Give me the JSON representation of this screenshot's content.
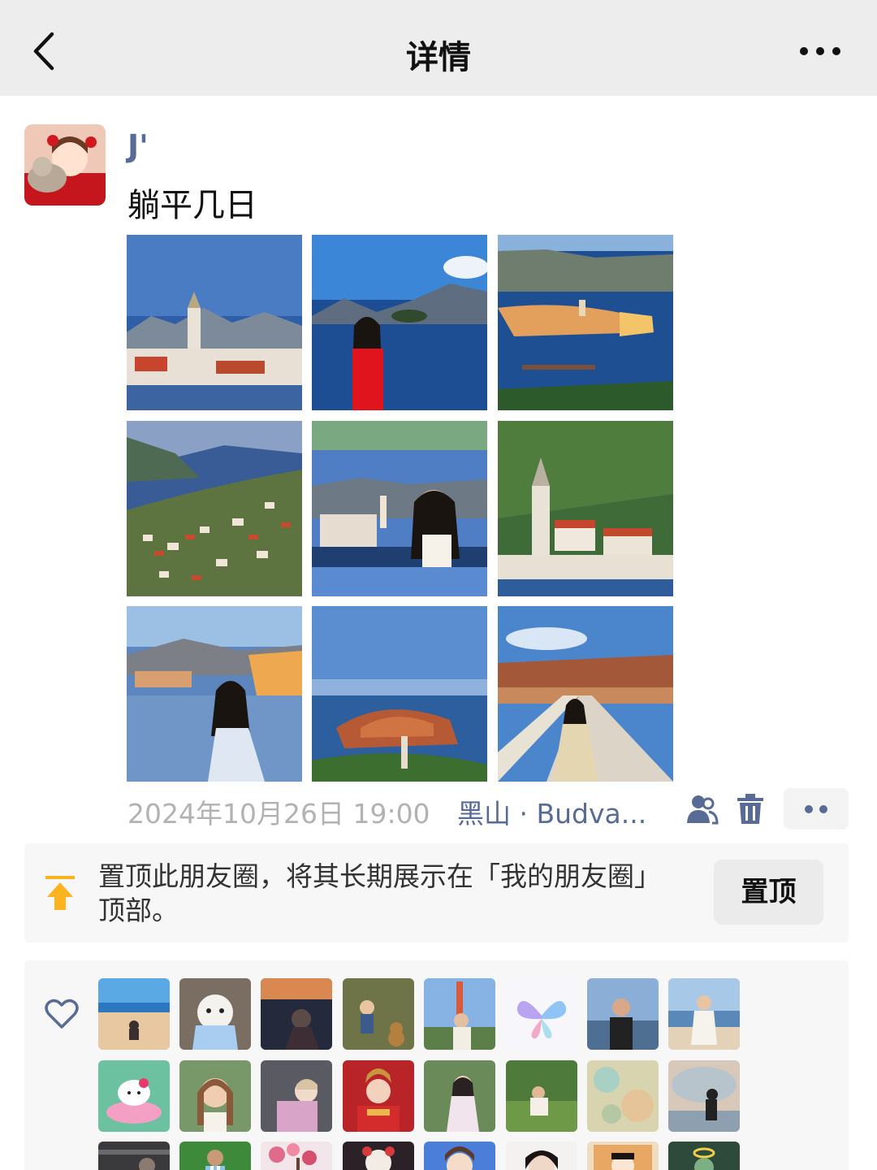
{
  "nav": {
    "title": "详情",
    "back_icon": "chevron-left-icon",
    "more_icon": "more-horizontal-icon"
  },
  "post": {
    "username": "J'",
    "text": "躺平几日",
    "photos": [
      {
        "name": "perast-church-tower-photo"
      },
      {
        "name": "woman-red-dress-bay-photo"
      },
      {
        "name": "budva-old-town-aerial-photo"
      },
      {
        "name": "kotor-bay-village-photo"
      },
      {
        "name": "woman-sunglasses-selfie-photo"
      },
      {
        "name": "perast-bell-tower-photo"
      },
      {
        "name": "woman-sitting-by-sea-photo"
      },
      {
        "name": "sveti-stefan-island-photo"
      },
      {
        "name": "woman-on-causeway-photo"
      }
    ],
    "time": "2024年10月26日 19:00",
    "location": "黑山 · Budva...",
    "dots_label": "••"
  },
  "pin": {
    "text": "置顶此朋友圈，将其长期展示在「我的朋友圈」顶部。",
    "button_label": "置顶",
    "accent": "#fbb320"
  },
  "likes": {
    "heart_icon": "heart-outline-icon",
    "avatars": [
      {
        "name": "like-avatar-beach"
      },
      {
        "name": "like-avatar-puppy"
      },
      {
        "name": "like-avatar-sunset"
      },
      {
        "name": "like-avatar-child-teddy"
      },
      {
        "name": "like-avatar-city-tower"
      },
      {
        "name": "like-avatar-butterfly"
      },
      {
        "name": "like-avatar-man-lake"
      },
      {
        "name": "like-avatar-woman-beach"
      },
      {
        "name": "like-avatar-hello-kitty"
      },
      {
        "name": "like-avatar-girl-smile"
      },
      {
        "name": "like-avatar-baby-car"
      },
      {
        "name": "like-avatar-bride"
      },
      {
        "name": "like-avatar-woman-plants"
      },
      {
        "name": "like-avatar-grass-field"
      },
      {
        "name": "like-avatar-painting"
      },
      {
        "name": "like-avatar-cloud-silhouette"
      },
      {
        "name": "like-avatar-dark-city"
      },
      {
        "name": "like-avatar-football"
      },
      {
        "name": "like-avatar-blossoms"
      },
      {
        "name": "like-avatar-toy"
      },
      {
        "name": "like-avatar-anime-boy"
      },
      {
        "name": "like-avatar-woman-portrait"
      },
      {
        "name": "like-avatar-cartoon"
      },
      {
        "name": "like-avatar-green"
      }
    ]
  },
  "colors": {
    "link": "#576b95",
    "meta": "#b2b2b2",
    "nav_bg": "#ededed",
    "card_bg": "#f7f7f7"
  }
}
